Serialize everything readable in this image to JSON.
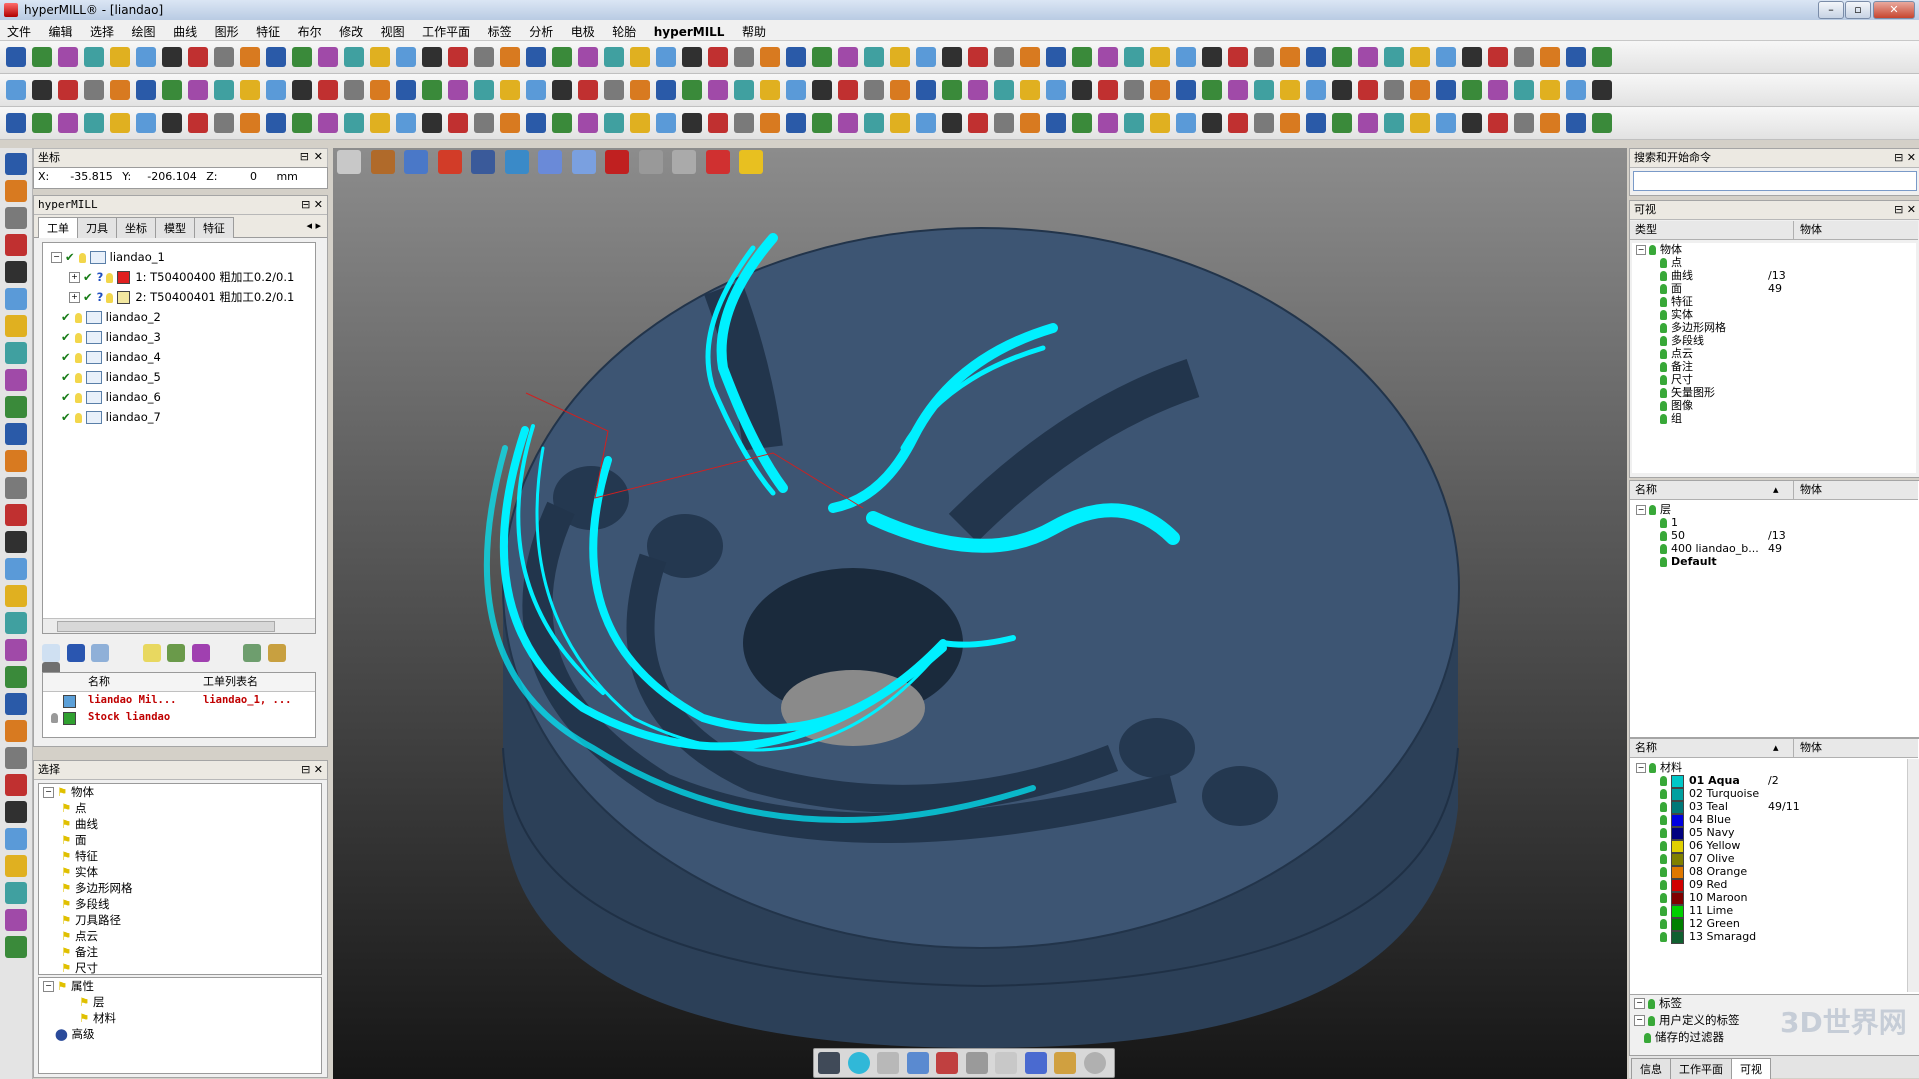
{
  "window": {
    "title": "hyperMILL® - [liandao]"
  },
  "menu": [
    "文件",
    "编辑",
    "选择",
    "绘图",
    "曲线",
    "图形",
    "特征",
    "布尔",
    "修改",
    "视图",
    "工作平面",
    "标签",
    "分析",
    "电极",
    "轮胎",
    "hyperMILL",
    "帮助"
  ],
  "coord_panel": {
    "title": "坐标",
    "x_label": "X:",
    "x": "-35.815",
    "y_label": "Y:",
    "y": "-206.104",
    "z_label": "Z:",
    "z": "0",
    "unit": "mm"
  },
  "hypermill_panel": {
    "title": "hyperMILL",
    "tabs": [
      "工单",
      "刀具",
      "坐标",
      "模型",
      "特征"
    ],
    "jobs": [
      {
        "label": "liandao_1"
      },
      {
        "label": "1: T50400400  粗加工0.2/0.1"
      },
      {
        "label": "2: T50400401  粗加工0.2/0.1"
      },
      {
        "label": "liandao_2"
      },
      {
        "label": "liandao_3"
      },
      {
        "label": "liandao_4"
      },
      {
        "label": "liandao_5"
      },
      {
        "label": "liandao_6"
      },
      {
        "label": "liandao_7"
      }
    ],
    "list_headers": [
      "名称",
      "工单列表名"
    ],
    "list_rows": [
      {
        "name": "liandao Mil...",
        "job": "liandao_1, ..."
      },
      {
        "name": "Stock liandao",
        "job": ""
      }
    ]
  },
  "selection_panel": {
    "title": "选择",
    "items": [
      "物体",
      "点",
      "曲线",
      "面",
      "特征",
      "实体",
      "多边形网格",
      "多段线",
      "刀具路径",
      "点云",
      "备注",
      "尺寸"
    ],
    "attributes": [
      "属性",
      "层",
      "材料",
      "高级"
    ]
  },
  "search_panel": {
    "title": "搜索和开始命令",
    "value": ""
  },
  "visible_panel": {
    "title": "可视",
    "headers": [
      "类型",
      "物体"
    ],
    "items": [
      {
        "label": "物体",
        "count": ""
      },
      {
        "label": "点",
        "count": ""
      },
      {
        "label": "曲线",
        "count": "/13"
      },
      {
        "label": "面",
        "count": "49"
      },
      {
        "label": "特征",
        "count": ""
      },
      {
        "label": "实体",
        "count": ""
      },
      {
        "label": "多边形网格",
        "count": ""
      },
      {
        "label": "多段线",
        "count": ""
      },
      {
        "label": "点云",
        "count": ""
      },
      {
        "label": "备注",
        "count": ""
      },
      {
        "label": "尺寸",
        "count": ""
      },
      {
        "label": "矢量图形",
        "count": ""
      },
      {
        "label": "图像",
        "count": ""
      },
      {
        "label": "组",
        "count": ""
      }
    ]
  },
  "layer_panel": {
    "headers": [
      "名称",
      "物体"
    ],
    "items": [
      {
        "label": "层",
        "count": ""
      },
      {
        "label": "1",
        "count": ""
      },
      {
        "label": "50",
        "count": "/13"
      },
      {
        "label": "400 liandao_b...",
        "count": "49"
      },
      {
        "label": "Default",
        "count": ""
      }
    ]
  },
  "material_panel": {
    "headers": [
      "名称",
      "物体"
    ],
    "items": [
      {
        "label": "材料",
        "count": "",
        "color": ""
      },
      {
        "label": "01 Aqua",
        "count": "/2",
        "color": "#00c8c8"
      },
      {
        "label": "02 Turquoise",
        "count": "",
        "color": "#00a0a0"
      },
      {
        "label": "03 Teal",
        "count": "49/11",
        "color": "#007878"
      },
      {
        "label": "04 Blue",
        "count": "",
        "color": "#0000e0"
      },
      {
        "label": "05 Navy",
        "count": "",
        "color": "#000080"
      },
      {
        "label": "06 Yellow",
        "count": "",
        "color": "#e0d000"
      },
      {
        "label": "07 Olive",
        "count": "",
        "color": "#808000"
      },
      {
        "label": "08 Orange",
        "count": "",
        "color": "#e07800"
      },
      {
        "label": "09 Red",
        "count": "",
        "color": "#d00000"
      },
      {
        "label": "10 Maroon",
        "count": "",
        "color": "#800000"
      },
      {
        "label": "11 Lime",
        "count": "",
        "color": "#00d000"
      },
      {
        "label": "12 Green",
        "count": "",
        "color": "#008000"
      },
      {
        "label": "13 Smaragd",
        "count": "",
        "color": "#106030"
      }
    ],
    "footer_items": [
      "标签",
      "用户定义的标签",
      "储存的过滤器"
    ],
    "bottom_tabs": [
      "信息",
      "工作平面",
      "可视"
    ]
  },
  "watermark": "3D世界网",
  "colors": {
    "part": "#3d5573",
    "toolpath": "#00f0ff",
    "viewport_top": "#8a8a8a",
    "viewport_bottom": "#101010"
  }
}
